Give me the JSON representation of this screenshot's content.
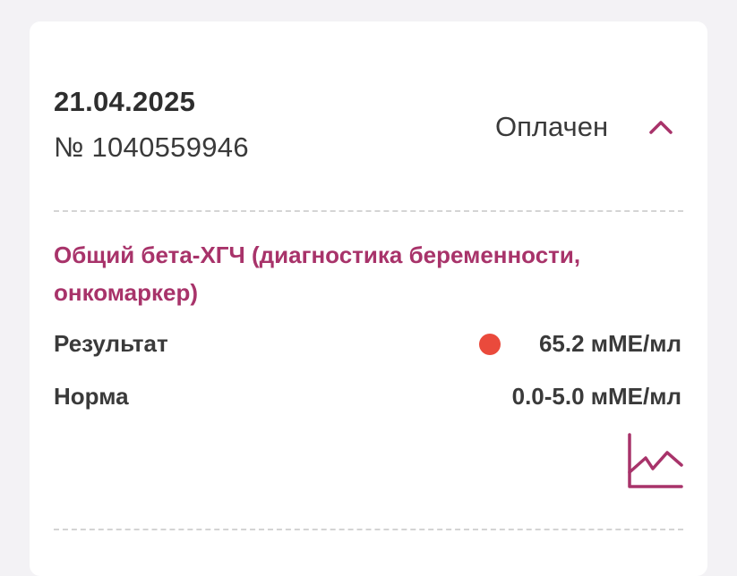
{
  "order": {
    "date": "21.04.2025",
    "number": "№ 1040559946",
    "status": "Оплачен",
    "icons": {
      "collapse": "chevron-up-icon",
      "trend": "line-chart-icon"
    }
  },
  "test": {
    "name": "Общий бета-ХГЧ (диагностика беременности, онкомаркер)",
    "result_label": "Результат",
    "result_value": "65.2 мМЕ/мл",
    "result_status_color": "#ea4a3c",
    "norm_label": "Норма",
    "norm_value": "0.0-5.0 мМЕ/мл"
  },
  "colors": {
    "accent": "#a8336a",
    "text": "#3a3a3a",
    "out_of_range": "#ea4a3c"
  }
}
